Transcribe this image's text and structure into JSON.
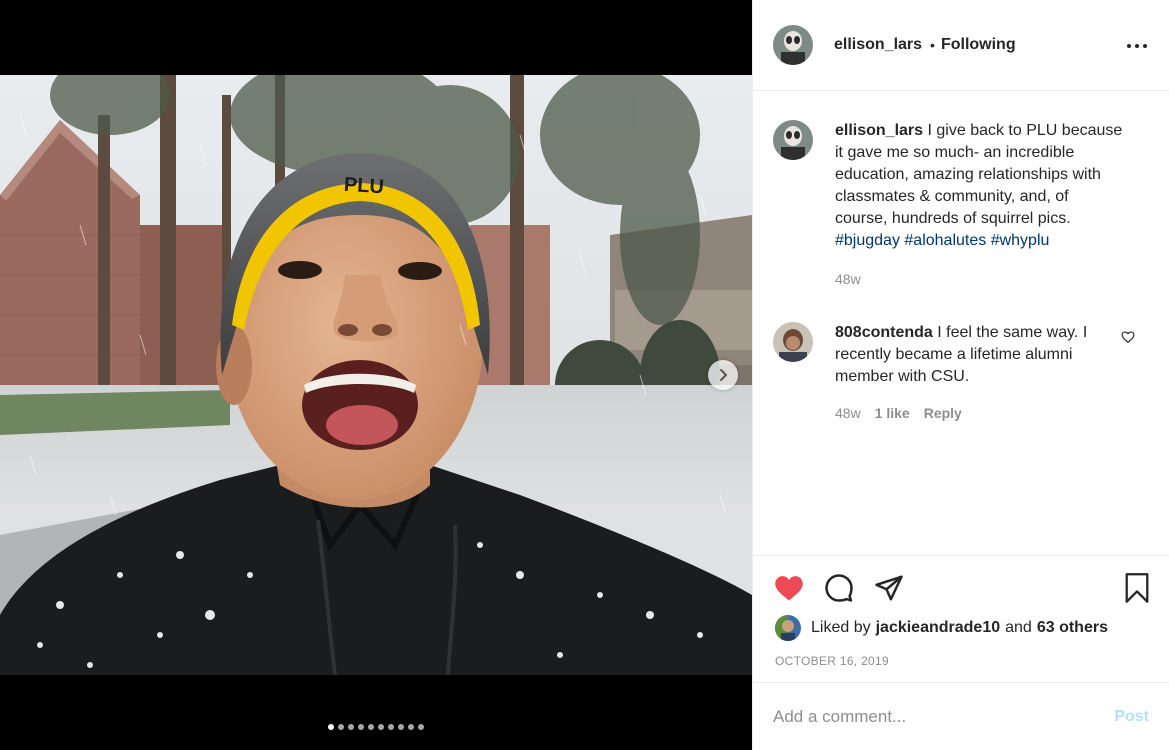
{
  "post": {
    "username": "ellison_lars",
    "follow_separator": "•",
    "follow_state": "Following",
    "more_icon": "more-horizontal-icon"
  },
  "media": {
    "hat_text": "PLU",
    "slide_count": 10,
    "active_slide": 1,
    "next_icon": "chevron-right-icon"
  },
  "caption": {
    "username": "ellison_lars",
    "text": "I give back to PLU because it gave me so much- an incredible education, amazing relationships with classmates & community, and, of course, hundreds of squirrel pics.",
    "hashtags": [
      "#bjugday",
      "#alohalutes",
      "#whyplu"
    ],
    "time": "48w"
  },
  "comment": {
    "username": "808contenda",
    "text": "I feel the same way. I recently became a lifetime alumni member with CSU.",
    "time": "48w",
    "likes": "1 like",
    "reply_label": "Reply",
    "like_icon": "heart-outline-icon"
  },
  "actions": {
    "like_icon": "heart-filled-icon",
    "comment_icon": "comment-icon",
    "share_icon": "send-icon",
    "save_icon": "bookmark-icon",
    "like_color": "#ed4956"
  },
  "likes": {
    "prefix": "Liked by",
    "user": "jackieandrade10",
    "conjunction": "and",
    "others": "63 others"
  },
  "date": "OCTOBER 16, 2019",
  "add_comment": {
    "placeholder": "Add a comment...",
    "post_label": "Post"
  }
}
